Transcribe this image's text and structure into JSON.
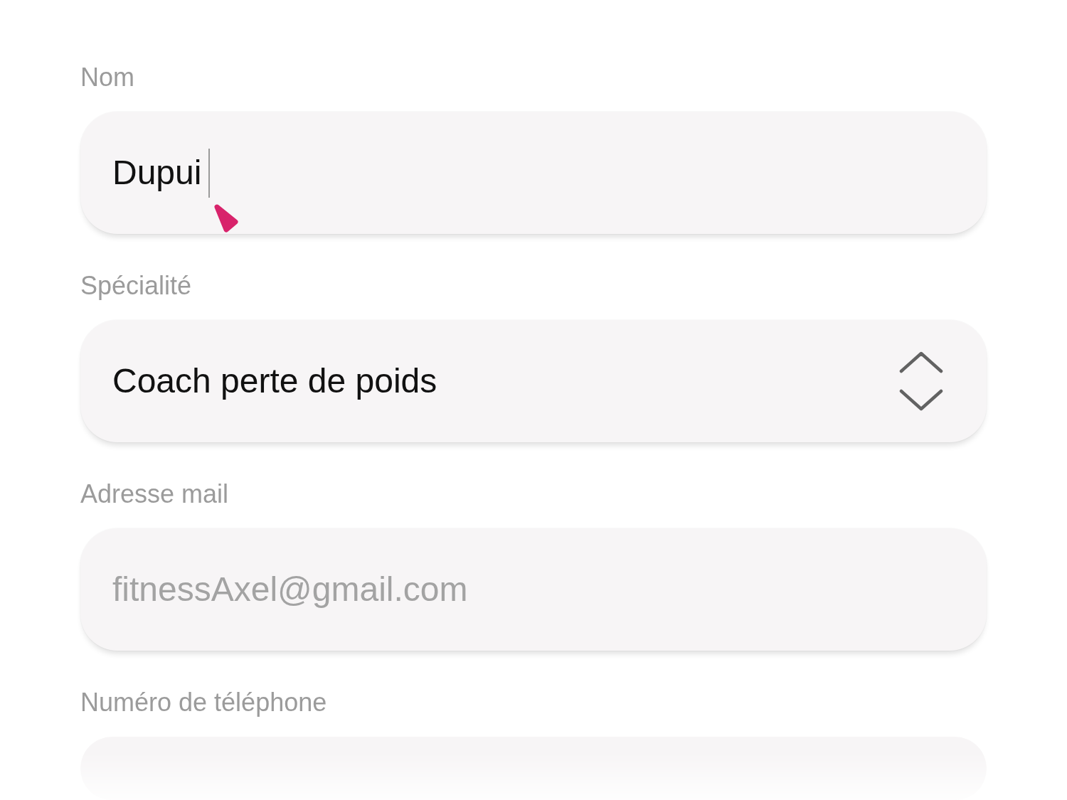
{
  "fields": [
    {
      "kind": "text",
      "label": "Nom",
      "value": "Dupui",
      "focused": true
    },
    {
      "kind": "select",
      "label": "Spécialité",
      "value": "Coach perte de poids",
      "focused": false
    },
    {
      "kind": "text",
      "label": "Adresse mail",
      "placeholder": "fitnessAxel@gmail.com",
      "focused": false
    },
    {
      "kind": "text",
      "label": "Numéro de téléphone",
      "focused": false
    }
  ]
}
